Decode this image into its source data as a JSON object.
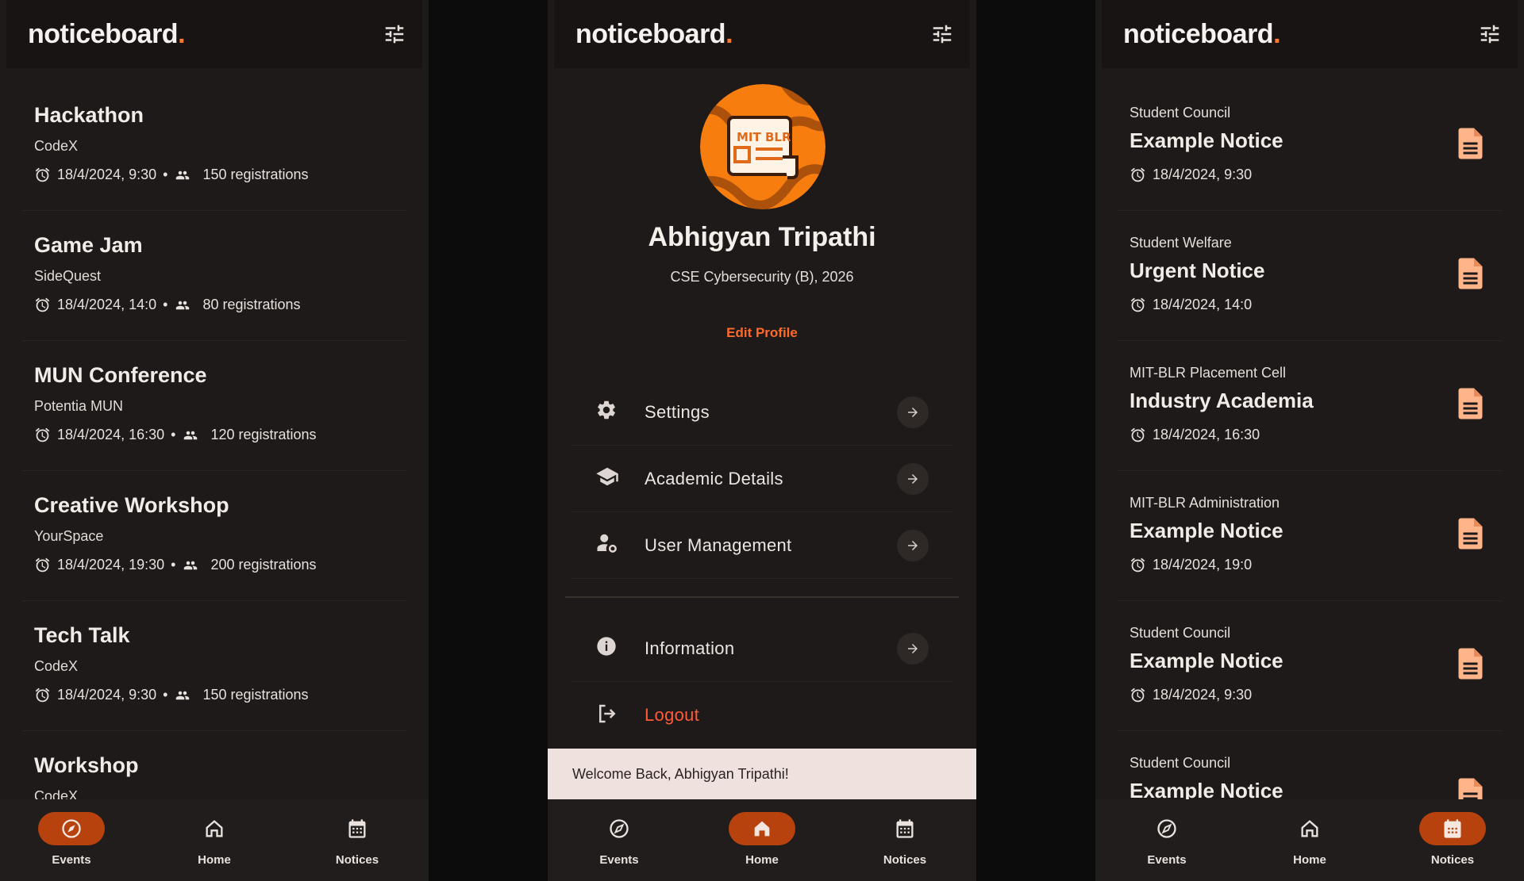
{
  "brand": {
    "name": "noticeboard",
    "dot": ".",
    "accent": "#ff7a2e"
  },
  "events": [
    {
      "title": "Hackathon",
      "org": "CodeX",
      "datetime": "18/4/2024, 9:30",
      "registrations": "150 registrations"
    },
    {
      "title": "Game Jam",
      "org": "SideQuest",
      "datetime": "18/4/2024, 14:0",
      "registrations": "80 registrations"
    },
    {
      "title": "MUN Conference",
      "org": "Potentia MUN",
      "datetime": "18/4/2024, 16:30",
      "registrations": "120 registrations"
    },
    {
      "title": "Creative Workshop",
      "org": "YourSpace",
      "datetime": "18/4/2024, 19:30",
      "registrations": "200 registrations"
    },
    {
      "title": "Tech Talk",
      "org": "CodeX",
      "datetime": "18/4/2024, 9:30",
      "registrations": "150 registrations"
    },
    {
      "title": "Workshop",
      "org": "CodeX",
      "datetime": "",
      "registrations": ""
    }
  ],
  "profile": {
    "avatar_text": "MIT BLR",
    "name": "Abhigyan Tripathi",
    "subtitle": "CSE Cybersecurity (B), 2026",
    "edit_label": "Edit Profile",
    "menu": [
      {
        "label": "Settings",
        "icon": "gear-icon"
      },
      {
        "label": "Academic Details",
        "icon": "graduation-cap-icon"
      },
      {
        "label": "User Management",
        "icon": "user-gear-icon"
      },
      {
        "label": "Information",
        "icon": "info-icon"
      },
      {
        "label": "Logout",
        "icon": "logout-icon"
      }
    ],
    "snackbar": "Welcome Back, Abhigyan Tripathi!"
  },
  "notices": [
    {
      "category": "Student Council",
      "title": "Example Notice",
      "datetime": "18/4/2024, 9:30"
    },
    {
      "category": "Student Welfare",
      "title": "Urgent Notice",
      "datetime": "18/4/2024, 14:0"
    },
    {
      "category": "MIT-BLR Placement Cell",
      "title": "Industry Academia",
      "datetime": "18/4/2024, 16:30"
    },
    {
      "category": "MIT-BLR Administration",
      "title": "Example Notice",
      "datetime": "18/4/2024, 19:0"
    },
    {
      "category": "Student Council",
      "title": "Example Notice",
      "datetime": "18/4/2024, 9:30"
    },
    {
      "category": "Student Council",
      "title": "Example Notice",
      "datetime": ""
    }
  ],
  "nav": {
    "events": "Events",
    "home": "Home",
    "notices": "Notices"
  },
  "colors": {
    "background": "#1e1a19",
    "active_pill": "#b8420e",
    "accent": "#ff6a2a",
    "doc_icon": "#ffb48a"
  }
}
